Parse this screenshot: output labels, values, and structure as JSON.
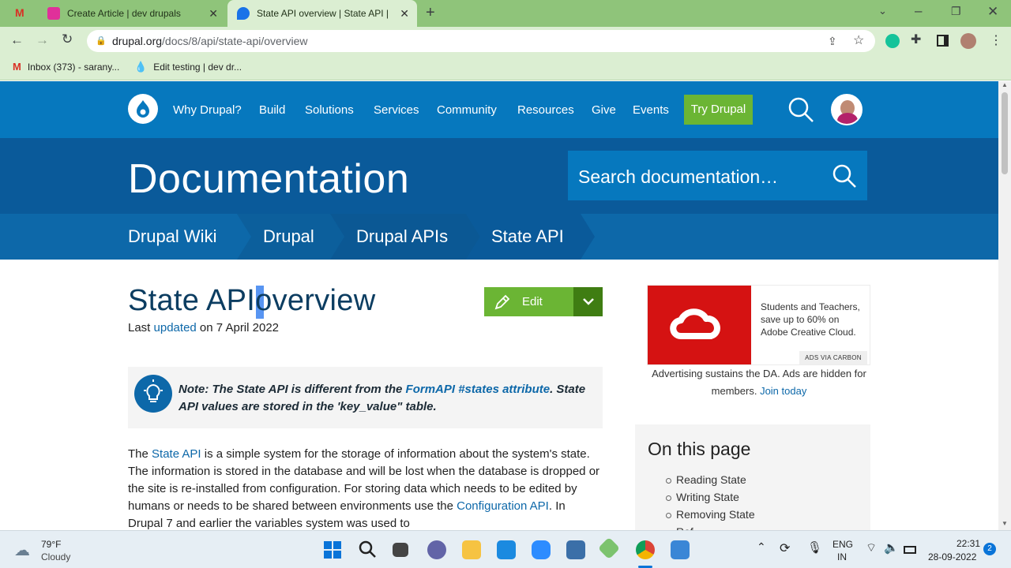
{
  "browser": {
    "tabs": [
      {
        "title": "Create Article | dev drupals",
        "color": "#e0309a"
      },
      {
        "title": "State API overview | State API | Dr",
        "color": "#1a73e8"
      }
    ],
    "url_host": "drupal.org",
    "url_path": "/docs/8/api/state-api/overview",
    "bookmarks": [
      "Inbox (373) - sarany...",
      "Edit testing | dev dr..."
    ]
  },
  "drupal_nav": {
    "items": [
      "Why Drupal?",
      "Build",
      "Solutions",
      "Services",
      "Community",
      "Resources",
      "Give",
      "Events"
    ],
    "cta": "Try Drupal"
  },
  "doc_header": {
    "title": "Documentation",
    "search_placeholder": "Search documentation…"
  },
  "breadcrumbs": [
    "Drupal Wiki",
    "Drupal",
    "Drupal APIs",
    "State API"
  ],
  "article": {
    "title_part1": "State API",
    "title_part2": "overview",
    "updated_prefix": "Last ",
    "updated_link": "updated",
    "updated_suffix": " on 7 April 2022",
    "edit_label": "Edit",
    "note_part1": "Note: The State API is different from the ",
    "note_link": "FormAPI #states attribute",
    "note_part2": ". State API values are stored in the 'key_value\" table.",
    "body_1": "The ",
    "body_link1": "State API",
    "body_2": " is a simple system for the storage of information about the system's state. The information is stored in the database and will be lost when the database is dropped or the site is re-installed from configuration. For storing data which needs to be edited by humans or needs to be shared between environments use the ",
    "body_link2": "Configuration API",
    "body_3": ". In Drupal 7 and earlier the variables system was used to"
  },
  "sidebar": {
    "ad_text": "Students and Teachers, save up to 60% on Adobe Creative Cloud.",
    "ad_badge": "ADS VIA CARBON",
    "ad_note": "Advertising sustains the DA. Ads are hidden for members. ",
    "ad_note_link": "Join today",
    "otp_title": "On this page",
    "otp_items": [
      "Reading State",
      "Writing State",
      "Removing State",
      "Ref..."
    ]
  },
  "taskbar": {
    "weather_temp": "79°F",
    "weather_desc": "Cloudy",
    "lang_1": "ENG",
    "lang_2": "IN",
    "time": "22:31",
    "date": "28-09-2022",
    "notif_count": "2"
  },
  "colors": {
    "drupal_blue": "#0678be",
    "drupal_green": "#6bb534"
  }
}
